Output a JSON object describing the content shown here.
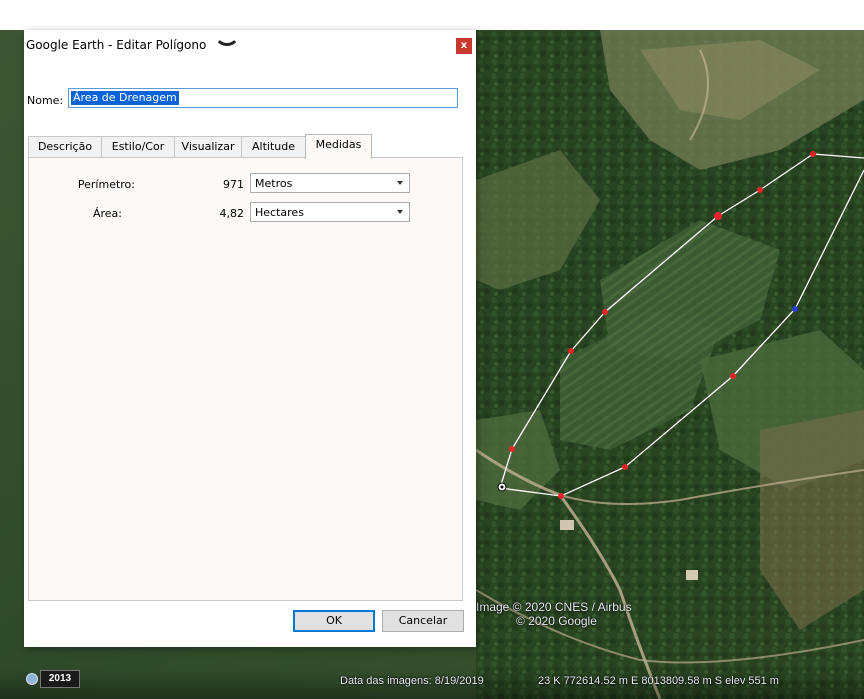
{
  "window": {
    "title": "Google Earth - Editar Polígono",
    "close_label": "x"
  },
  "name_field": {
    "label": "Nome:",
    "value": "Área de Drenagem"
  },
  "tabs": [
    {
      "label": "Descrição",
      "active": false
    },
    {
      "label": "Estilo/Cor",
      "active": false
    },
    {
      "label": "Visualizar",
      "active": false
    },
    {
      "label": "Altitude",
      "active": false
    },
    {
      "label": "Medidas",
      "active": true
    }
  ],
  "measures": {
    "perimeter": {
      "label": "Perímetro:",
      "value": "971",
      "unit": "Metros"
    },
    "area": {
      "label": "Área:",
      "value": "4,82",
      "unit": "Hectares"
    }
  },
  "buttons": {
    "ok": "OK",
    "cancel": "Cancelar"
  },
  "map": {
    "credit_1": "Image © 2020 CNES / Airbus",
    "credit_2": "© 2020 Google",
    "year": "2013",
    "imagery_date": "Data das imagens: 8/19/2019",
    "coordinates": "23 K 772614.52 m E 8013809.58 m S  elev  551 m",
    "vertex_color": "#e8242b",
    "active_vertex_color": "#2a3bd6",
    "line_color": "#ffffff"
  }
}
